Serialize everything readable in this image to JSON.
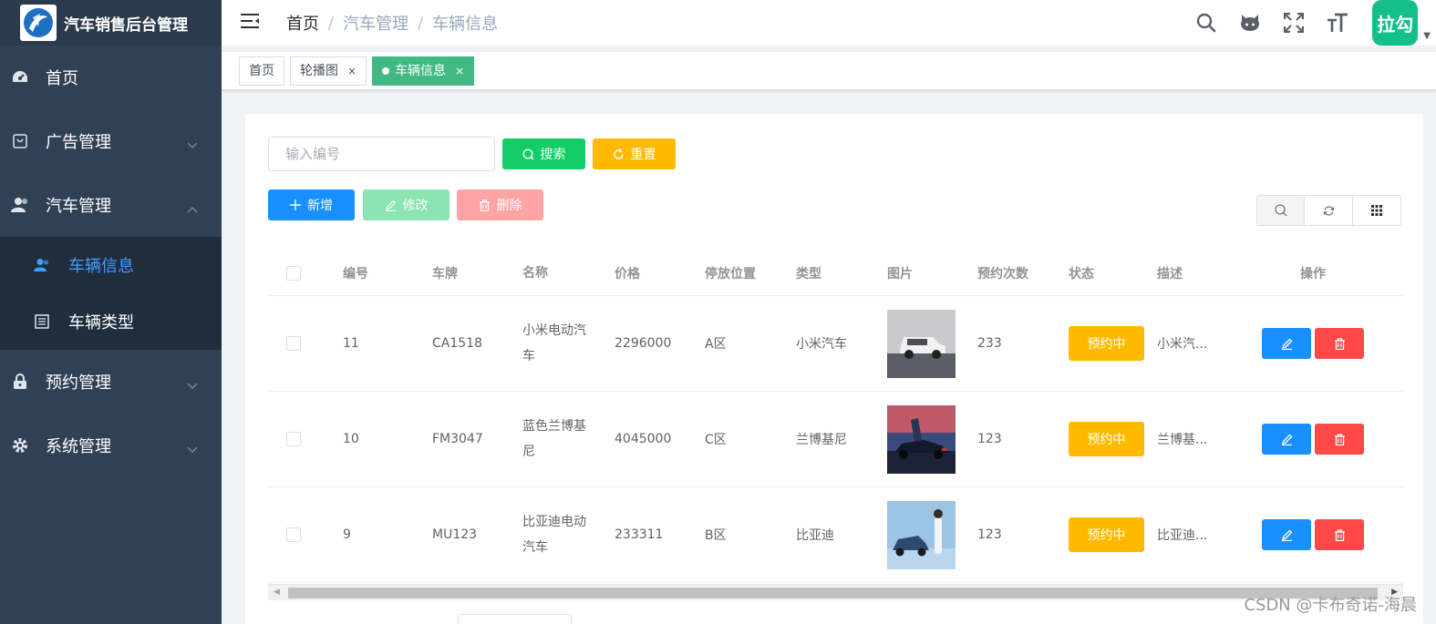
{
  "app": {
    "title": "汽车销售后台管理"
  },
  "sidebar": {
    "items": [
      {
        "label": "首页",
        "icon": "dashboard-icon"
      },
      {
        "label": "广告管理",
        "icon": "ad-icon"
      },
      {
        "label": "汽车管理",
        "icon": "user-icon",
        "expanded": true,
        "children": [
          {
            "label": "车辆信息",
            "icon": "people-icon",
            "active": true
          },
          {
            "label": "车辆类型",
            "icon": "list-icon"
          }
        ]
      },
      {
        "label": "预约管理",
        "icon": "lock-icon"
      },
      {
        "label": "系统管理",
        "icon": "gear-icon"
      }
    ]
  },
  "header": {
    "breadcrumb": [
      "首页",
      "汽车管理",
      "车辆信息"
    ],
    "separator": "/",
    "avatar_text": "拉勾"
  },
  "tags": [
    {
      "label": "首页",
      "closable": false,
      "active": false
    },
    {
      "label": "轮播图",
      "closable": true,
      "active": false
    },
    {
      "label": "车辆信息",
      "closable": true,
      "active": true
    }
  ],
  "search": {
    "placeholder": "输入编号",
    "search_label": "搜索",
    "reset_label": "重置"
  },
  "actions": {
    "add_label": "新增",
    "edit_label": "修改",
    "delete_label": "删除"
  },
  "table": {
    "columns": [
      "编号",
      "车牌",
      "名称",
      "价格",
      "停放位置",
      "类型",
      "图片",
      "预约次数",
      "状态",
      "描述",
      "操作"
    ],
    "rows": [
      {
        "id": "11",
        "plate": "CA1518",
        "name": "小米电动汽车",
        "price": "2296000",
        "location": "A区",
        "type": "小米汽车",
        "count": "233",
        "status": "预约中",
        "desc": "小米汽..."
      },
      {
        "id": "10",
        "plate": "FM3047",
        "name": "蓝色兰博基尼",
        "price": "4045000",
        "location": "C区",
        "type": "兰博基尼",
        "count": "123",
        "status": "预约中",
        "desc": "兰博基..."
      },
      {
        "id": "9",
        "plate": "MU123",
        "name": "比亚迪电动汽车",
        "price": "233311",
        "location": "B区",
        "type": "比亚迪",
        "count": "123",
        "status": "预约中",
        "desc": "比亚迪..."
      }
    ]
  },
  "watermark": "CSDN @卡布奇诺-海晨",
  "colors": {
    "sidebar_bg": "#304156",
    "active_menu": "#409eff",
    "tag_active": "#42b983",
    "success": "#13ce66",
    "warning": "#ffba00",
    "primary": "#1890ff",
    "danger": "#ff4949",
    "avatar": "#13c08a"
  }
}
